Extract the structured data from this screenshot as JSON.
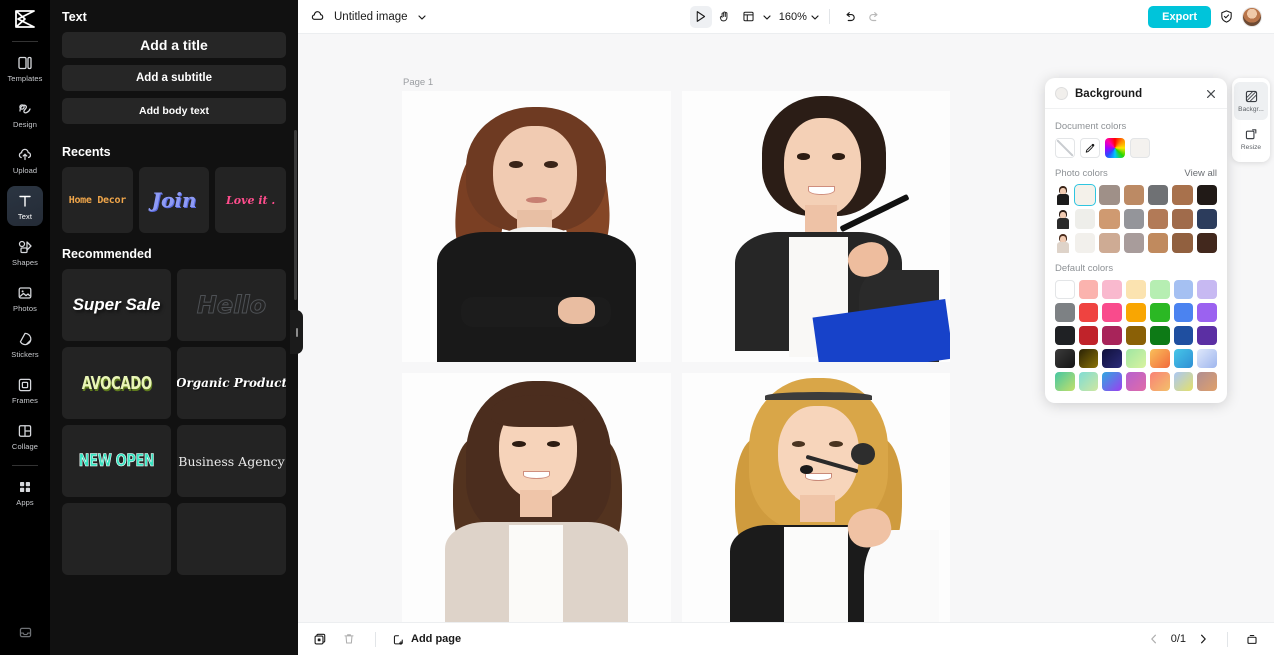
{
  "app": {
    "left_rail": {
      "logo_name": "capcut-logo",
      "items": [
        {
          "id": "templates",
          "label": "Templates",
          "icon": "templates-icon",
          "active": false
        },
        {
          "id": "design",
          "label": "Design",
          "icon": "design-icon",
          "active": false
        },
        {
          "id": "upload",
          "label": "Upload",
          "icon": "upload-cloud-icon",
          "active": false
        },
        {
          "id": "text",
          "label": "Text",
          "icon": "text-icon",
          "active": true
        },
        {
          "id": "shapes",
          "label": "Shapes",
          "icon": "shapes-icon",
          "active": false
        },
        {
          "id": "photos",
          "label": "Photos",
          "icon": "photos-icon",
          "active": false
        },
        {
          "id": "stickers",
          "label": "Stickers",
          "icon": "stickers-icon",
          "active": false
        },
        {
          "id": "frames",
          "label": "Frames",
          "icon": "frames-icon",
          "active": false
        },
        {
          "id": "collage",
          "label": "Collage",
          "icon": "collage-icon",
          "active": false
        },
        {
          "id": "apps",
          "label": "Apps",
          "icon": "apps-grid-icon",
          "active": false
        }
      ],
      "bottom_icon": "inbox-icon"
    },
    "text_panel": {
      "heading": "Text",
      "buttons": [
        {
          "label": "Add a title",
          "name": "add-title-button"
        },
        {
          "label": "Add a subtitle",
          "name": "add-subtitle-button"
        },
        {
          "label": "Add body text",
          "name": "add-body-text-button"
        }
      ],
      "recents_heading": "Recents",
      "recents": [
        {
          "label": "Home Decor",
          "style": "s-home"
        },
        {
          "label": "Join",
          "style": "s-join"
        },
        {
          "label": "Love it .",
          "style": "s-love"
        }
      ],
      "recommended_heading": "Recommended",
      "recommended": [
        {
          "label": "Super Sale",
          "style": "s-super"
        },
        {
          "label": "Hello",
          "style": "s-hello"
        },
        {
          "label": "AVOCADO",
          "style": "s-avo"
        },
        {
          "label": "Organic Product",
          "style": "s-org"
        },
        {
          "label": "NEW OPEN",
          "style": "s-new"
        },
        {
          "label": "Business Agency",
          "style": "s-bus"
        }
      ]
    },
    "topbar": {
      "cloud_icon": "cloud-sync-icon",
      "doc_title": "Untitled image",
      "title_caret": "chevron-down-icon",
      "tools": [
        {
          "name": "select-tool",
          "icon": "cursor-arrow-icon",
          "active": true
        },
        {
          "name": "hand-tool",
          "icon": "hand-icon",
          "active": false
        },
        {
          "name": "layout-tool",
          "icon": "layout-panel-icon",
          "active": false
        }
      ],
      "zoom_value": "160%",
      "zoom_caret": "chevron-down-icon",
      "undo_icon": "undo-arrow-icon",
      "redo_icon": "redo-arrow-icon",
      "export_label": "Export",
      "shield_icon": "shield-check-icon",
      "avatar_name": "user-avatar"
    },
    "canvas": {
      "page_label": "Page 1",
      "photos": [
        {
          "name": "photo-woman-dark-blazer"
        },
        {
          "name": "photo-woman-pen-binder"
        },
        {
          "name": "photo-woman-beige-jacket"
        },
        {
          "name": "photo-woman-headset"
        }
      ]
    },
    "bottombar": {
      "duplicate_icon": "duplicate-page-icon",
      "delete_icon": "trash-icon",
      "add_page_icon": "add-page-icon",
      "add_page_label": "Add page",
      "prev_icon": "chevron-left-icon",
      "page_counter": "0/1",
      "next_icon": "chevron-right-icon",
      "grid_icon": "page-grid-icon"
    },
    "background_panel": {
      "title": "Background",
      "close_icon": "close-icon",
      "document_colors_label": "Document colors",
      "document_colors": [
        {
          "type": "none",
          "name": "no-color-swatch"
        },
        {
          "type": "eyedropper",
          "name": "eyedropper-swatch"
        },
        {
          "type": "rainbow",
          "name": "color-picker-swatch"
        },
        {
          "type": "plain",
          "name": "document-color-swatch",
          "hex": "#f4f2ef"
        }
      ],
      "photo_colors_label": "Photo colors",
      "view_all_label": "View all",
      "photo_color_rows": [
        {
          "thumb": "photo-thumb-1",
          "colors": [
            "#f4f1ea",
            "#9f9088",
            "#bc8a64",
            "#6f7174",
            "#a8714c",
            "#211a17"
          ],
          "selected_index": 0
        },
        {
          "thumb": "photo-thumb-2",
          "colors": [
            "#eeeeea",
            "#cf9a71",
            "#94959a",
            "#b27a57",
            "#a06b4b",
            "#2c3c5c"
          ],
          "selected_index": -1
        },
        {
          "thumb": "photo-thumb-3",
          "colors": [
            "#f2f0ec",
            "#ceab94",
            "#a89c9b",
            "#c08a5e",
            "#91603f",
            "#42281d"
          ],
          "selected_index": -1
        }
      ],
      "default_colors_label": "Default colors",
      "default_color_rows": [
        [
          "#ffffff",
          "#fbb3ae",
          "#f9b9ce",
          "#fbe3b0",
          "#b6eeb2",
          "#a5c0f2",
          "#c7b9f2"
        ],
        [
          "#7d8184",
          "#ef4340",
          "#f94b8c",
          "#f9a602",
          "#2bb824",
          "#4b83f0",
          "#9b62f0"
        ],
        [
          "#1f2124",
          "#c0232a",
          "#a8245a",
          "#8a6006",
          "#0d7a16",
          "#1f4fa0",
          "#5b2fa3"
        ],
        [
          "#2b2b2b",
          "#6b5a08",
          "#1b1b4e",
          "#9fe6a2",
          "#f79441",
          "#35a8df",
          "#c2d2f5"
        ],
        [
          "#46c6a2",
          "#7fdcd4",
          "#7b5cf0",
          "#b661cf",
          "#f98276",
          "#dce06a",
          "#b08e92"
        ]
      ]
    },
    "right_rail": {
      "items": [
        {
          "label": "Backgr...",
          "icon": "background-icon",
          "name": "background-tool",
          "active": true
        },
        {
          "label": "Resize",
          "icon": "resize-icon",
          "name": "resize-tool",
          "active": false
        }
      ]
    }
  }
}
